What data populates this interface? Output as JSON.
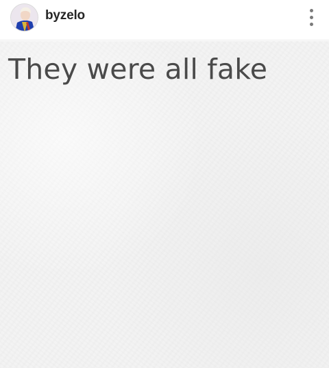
{
  "header": {
    "username": "byzelo",
    "avatar_icon": "profile-photo",
    "more_icon": "vertical-ellipsis-icon"
  },
  "post": {
    "text": "They were all fake",
    "background_color": "#f3f3f3",
    "text_color": "#4a4a4a"
  }
}
